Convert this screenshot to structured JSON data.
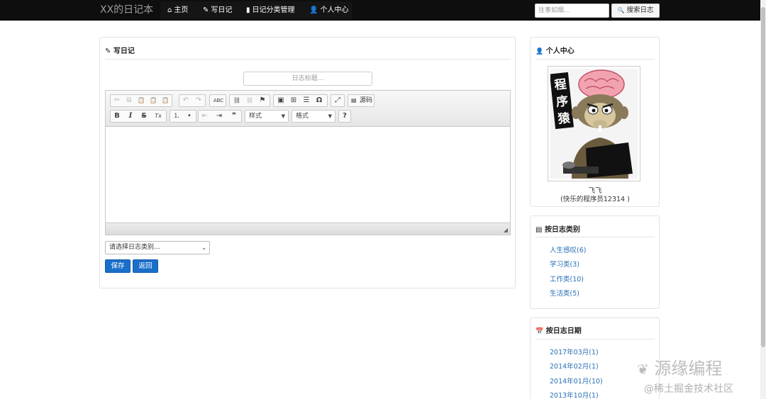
{
  "navbar": {
    "brand": "XX的日记本",
    "items": [
      {
        "label": "主页",
        "icon": "home-icon",
        "glyph": "⌂"
      },
      {
        "label": "写日记",
        "icon": "pencil-icon",
        "glyph": "✎"
      },
      {
        "label": "日记分类管理",
        "icon": "book-icon",
        "glyph": "▮"
      },
      {
        "label": "个人中心",
        "icon": "user-icon",
        "glyph": "👤"
      }
    ],
    "search_placeholder": "往事如烟...",
    "search_button": "搜索日志",
    "search_glyph": "🔍"
  },
  "write_panel": {
    "title": "写日记",
    "title_glyph": "✎",
    "diary_title_placeholder": "日志标题...",
    "editor": {
      "row1": [
        {
          "name": "cut-icon",
          "glyph": "✂",
          "disabled": true
        },
        {
          "name": "copy-icon",
          "glyph": "⧉",
          "disabled": true
        },
        {
          "name": "paste-icon",
          "glyph": "📋",
          "disabled": false
        },
        {
          "name": "paste-text-icon",
          "glyph": "📋",
          "disabled": false
        },
        {
          "name": "paste-word-icon",
          "glyph": "📋",
          "disabled": false
        },
        {
          "name": "undo-icon",
          "glyph": "↶",
          "disabled": true
        },
        {
          "name": "redo-icon",
          "glyph": "↷",
          "disabled": true
        },
        {
          "name": "spellcheck-icon",
          "glyph": "ABC",
          "disabled": false
        },
        {
          "name": "link-icon",
          "glyph": "⛓",
          "disabled": false
        },
        {
          "name": "unlink-icon",
          "glyph": "⛓",
          "disabled": true
        },
        {
          "name": "anchor-icon",
          "glyph": "⚑",
          "disabled": false
        },
        {
          "name": "image-icon",
          "glyph": "▣",
          "disabled": false
        },
        {
          "name": "table-icon",
          "glyph": "⊞",
          "disabled": false
        },
        {
          "name": "hline-icon",
          "glyph": "☰",
          "disabled": false
        },
        {
          "name": "special-char-icon",
          "glyph": "Ω",
          "disabled": false
        },
        {
          "name": "maximize-icon",
          "glyph": "⤢",
          "disabled": false
        }
      ],
      "source_label": "源码",
      "row2": [
        {
          "name": "bold-icon",
          "glyph": "B"
        },
        {
          "name": "italic-icon",
          "glyph": "I"
        },
        {
          "name": "strike-icon",
          "glyph": "S"
        },
        {
          "name": "remove-format-icon",
          "glyph": "Tx"
        },
        {
          "name": "numbered-list-icon",
          "glyph": "⒈"
        },
        {
          "name": "bulleted-list-icon",
          "glyph": "•"
        },
        {
          "name": "outdent-icon",
          "glyph": "⇤"
        },
        {
          "name": "indent-icon",
          "glyph": "⇥"
        },
        {
          "name": "blockquote-icon",
          "glyph": "❞"
        }
      ],
      "style_combo": "样式",
      "format_combo": "格式",
      "help_glyph": "?"
    },
    "category_select": "请选择日志类别...",
    "save_button": "保存",
    "back_button": "返回"
  },
  "profile_panel": {
    "title": "个人中心",
    "title_glyph": "👤",
    "avatar_text": "程序猿",
    "name": "飞飞",
    "motto": "(快乐的程序员12314 )"
  },
  "category_panel": {
    "title": "按日志类别",
    "title_glyph": "▤",
    "items": [
      "人生感叹(6)",
      "学习类(3)",
      "工作类(10)",
      "生活类(5)"
    ]
  },
  "date_panel": {
    "title": "按日志日期",
    "title_glyph": "📅",
    "items": [
      "2017年03月(1)",
      "2014年02月(1)",
      "2014年01月(10)",
      "2013年10月(1)"
    ]
  },
  "watermark": {
    "main": "源缘编程",
    "sub": "@稀土掘金技术社区"
  }
}
